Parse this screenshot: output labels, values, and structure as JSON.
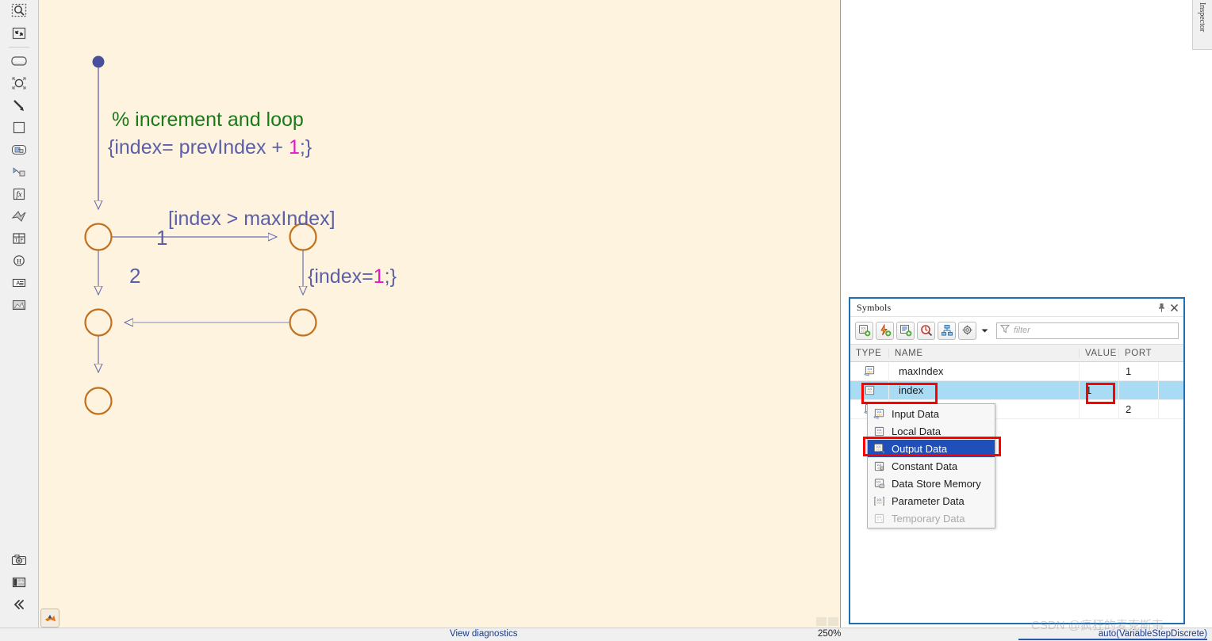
{
  "toolbar": {
    "items_top": [
      {
        "name": "zoom-fit-icon",
        "label": "Fit to View"
      },
      {
        "name": "expand-icon",
        "label": "Full Screen"
      },
      {
        "name": "rounded-rect-state-icon",
        "label": "State"
      },
      {
        "name": "junction-icon",
        "label": "Default Transition / Junction"
      },
      {
        "name": "transition-arrow-icon",
        "label": "Transition"
      },
      {
        "name": "box-icon",
        "label": "Box"
      },
      {
        "name": "graphical-function-icon",
        "label": "Graphical Function"
      },
      {
        "name": "simulink-function-icon",
        "label": "Simulink Function"
      },
      {
        "name": "matlab-function-icon",
        "label": "MATLAB Function"
      },
      {
        "name": "simulink-state-icon",
        "label": "Simulink State"
      },
      {
        "name": "truth-table-icon",
        "label": "Truth Table"
      },
      {
        "name": "history-junction-icon",
        "label": "History Junction"
      },
      {
        "name": "annotation-text-icon",
        "label": "Annotation"
      },
      {
        "name": "image-annotation-icon",
        "label": "Image"
      }
    ],
    "items_bottom": [
      {
        "name": "camera-icon",
        "label": "Snapshot"
      },
      {
        "name": "layout-icon",
        "label": "Layout"
      },
      {
        "name": "collapse-panel-icon",
        "label": "Collapse"
      }
    ]
  },
  "canvas": {
    "comment": "% increment and loop",
    "action_prefix": "{index= prevIndex + ",
    "action_number": "1",
    "action_suffix": ";}",
    "condition": "[index > maxIndex]",
    "reset_prefix": "{index=",
    "reset_number": "1",
    "reset_suffix": ";}",
    "order_1": "1",
    "order_2": "2",
    "matlab_badge": "matlab-icon",
    "colors": {
      "background": "#fdf3df",
      "junction_stroke": "#c2701d",
      "transition": "#6b6fae",
      "comment_text": "#1a7a1a",
      "action_text": "#5c5fa8",
      "literal_text": "#e617c9",
      "start_dot": "#4a4f9c"
    }
  },
  "inspector_tab": {
    "label": "Inspector"
  },
  "symbols_panel": {
    "title": "Symbols",
    "pin_icon": "pin-icon",
    "close_icon": "close-icon",
    "toolbar_buttons": [
      {
        "name": "add-data-icon",
        "label": "Add Data"
      },
      {
        "name": "add-event-icon",
        "label": "Add Event"
      },
      {
        "name": "add-message-icon",
        "label": "Add Message"
      },
      {
        "name": "resolve-undefined-icon",
        "label": "Resolve Undefined Symbols"
      },
      {
        "name": "model-explorer-icon",
        "label": "Model Explorer"
      },
      {
        "name": "settings-gear-icon",
        "label": "Settings"
      },
      {
        "name": "chevron-down-icon",
        "label": "More"
      }
    ],
    "filter": {
      "placeholder": "filter",
      "value": "",
      "icon": "funnel-icon"
    },
    "columns": [
      "TYPE",
      "NAME",
      "VALUE",
      "PORT"
    ],
    "rows": [
      {
        "type_icon": "input-data-icon",
        "name": "maxIndex",
        "value": "",
        "port": "1",
        "selected": false
      },
      {
        "type_icon": "local-data-icon",
        "name": "index",
        "value": "1",
        "port": "",
        "selected": true
      },
      {
        "type_icon": "input-data-icon",
        "name": "",
        "value": "",
        "port": "2",
        "selected": false
      }
    ]
  },
  "context_menu": {
    "items": [
      {
        "label": "Input Data",
        "icon": "input-data-icon",
        "selected": false,
        "disabled": false
      },
      {
        "label": "Local Data",
        "icon": "local-data-icon",
        "selected": false,
        "disabled": false
      },
      {
        "label": "Output Data",
        "icon": "output-data-icon",
        "selected": true,
        "disabled": false
      },
      {
        "label": "Constant Data",
        "icon": "constant-data-icon",
        "selected": false,
        "disabled": false
      },
      {
        "label": "Data Store Memory",
        "icon": "data-store-memory-icon",
        "selected": false,
        "disabled": false
      },
      {
        "label": "Parameter Data",
        "icon": "parameter-data-icon",
        "selected": false,
        "disabled": false
      },
      {
        "label": "Temporary Data",
        "icon": "temporary-data-icon",
        "selected": false,
        "disabled": true
      }
    ]
  },
  "status_bar": {
    "diagnostics": "View diagnostics",
    "zoom": "250%",
    "solver": "auto(VariableStepDiscrete)"
  },
  "watermark": {
    "text": "CSDN @疯狂的麦克斯韦"
  }
}
